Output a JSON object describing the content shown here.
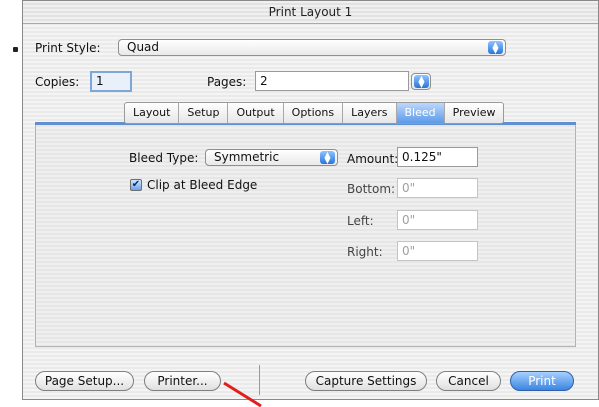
{
  "window": {
    "title": "Print Layout 1"
  },
  "header": {
    "print_style_label": "Print Style:",
    "print_style_value": "Quad",
    "copies_label": "Copies:",
    "copies_value": "1",
    "pages_label": "Pages:",
    "pages_value": "2"
  },
  "tabs": [
    {
      "label": "Layout"
    },
    {
      "label": "Setup"
    },
    {
      "label": "Output"
    },
    {
      "label": "Options"
    },
    {
      "label": "Layers"
    },
    {
      "label": "Bleed"
    },
    {
      "label": "Preview"
    }
  ],
  "active_tab": "Bleed",
  "bleed": {
    "bleed_type_label": "Bleed Type:",
    "bleed_type_value": "Symmetric",
    "clip_label": "Clip at Bleed Edge",
    "clip_checked": true,
    "amount_label": "Amount:",
    "amount_value": "0.125\"",
    "bottom_label": "Bottom:",
    "bottom_value": "0\"",
    "left_label": "Left:",
    "left_value": "0\"",
    "right_label": "Right:",
    "right_value": "0\""
  },
  "buttons": {
    "page_setup": "Page Setup...",
    "printer": "Printer...",
    "capture_settings": "Capture Settings",
    "cancel": "Cancel",
    "print": "Print"
  },
  "colors": {
    "accent": "#3b85e0",
    "annotation_arrow": "#e0201c"
  }
}
